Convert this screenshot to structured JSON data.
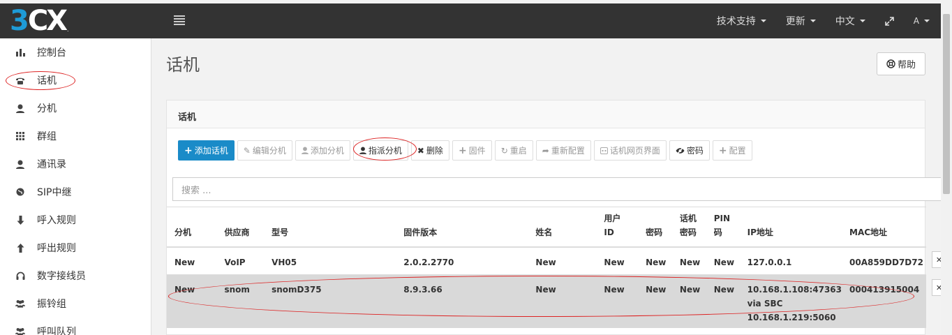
{
  "brand": {
    "logo_accent": "3",
    "logo_main": "CX",
    "logo_mark": "."
  },
  "topnav": {
    "support": "技术支持",
    "updates": "更新",
    "language": "中文",
    "user": "A"
  },
  "sidebar": {
    "items": [
      {
        "label": "控制台",
        "icon": "bar-chart-icon"
      },
      {
        "label": "话机",
        "icon": "phone-icon"
      },
      {
        "label": "分机",
        "icon": "user-icon"
      },
      {
        "label": "群组",
        "icon": "grid-icon"
      },
      {
        "label": "通讯录",
        "icon": "contact-icon"
      },
      {
        "label": "SIP中继",
        "icon": "globe-icon"
      },
      {
        "label": "呼入规则",
        "icon": "arrow-down-icon"
      },
      {
        "label": "呼出规则",
        "icon": "arrow-up-icon"
      },
      {
        "label": "数字接线员",
        "icon": "headset-icon"
      },
      {
        "label": "振铃组",
        "icon": "users-icon"
      },
      {
        "label": "呼叫队列",
        "icon": "queue-icon"
      }
    ]
  },
  "page": {
    "title": "话机",
    "help": "帮助"
  },
  "panel": {
    "title": "话机"
  },
  "toolbar": {
    "add_phone": "添加话机",
    "edit_ext": "编辑分机",
    "add_ext": "添加分机",
    "assign_ext": "指派分机",
    "delete": "删除",
    "firmware": "固件",
    "restart": "重启",
    "reprovision": "重新配置",
    "phone_web": "话机网页界面",
    "password": "密码",
    "config": "配置"
  },
  "search": {
    "placeholder": "搜索 ..."
  },
  "table": {
    "headers": {
      "ext": "分机",
      "vendor": "供应商",
      "model": "型号",
      "firmware": "固件版本",
      "name": "姓名",
      "userid_1": "用户",
      "userid_2": "ID",
      "pwd": "密码",
      "phonepwd_1": "话机",
      "phonepwd_2": "密码",
      "pin_1": "PIN",
      "pin_2": "码",
      "ip": "IP地址",
      "mac": "MAC地址"
    },
    "rows": [
      {
        "ext": "New",
        "vendor": "VoIP",
        "model": "VH05",
        "firmware": "2.0.2.2770",
        "name": "New",
        "userid": "New",
        "pwd": "New",
        "phonepwd": "New",
        "pin": "New",
        "ip_1": "127.0.0.1",
        "ip_2": "",
        "ip_3": "",
        "mac": "00A859DD7D72"
      },
      {
        "ext": "New",
        "vendor": "snom",
        "model": "snomD375",
        "firmware": "8.9.3.66",
        "name": "New",
        "userid": "New",
        "pwd": "New",
        "phonepwd": "New",
        "pin": "New",
        "ip_1": "10.168.1.108:47363",
        "ip_2": "via SBC",
        "ip_3": "10.168.1.219:5060",
        "mac": "000413915004"
      }
    ]
  },
  "colors": {
    "topbar": "#333333",
    "primary": "#1a8bc8",
    "brand_blue": "#1e9bd7",
    "annotation": "#dd2222",
    "selected_row": "#d9d9d9"
  }
}
